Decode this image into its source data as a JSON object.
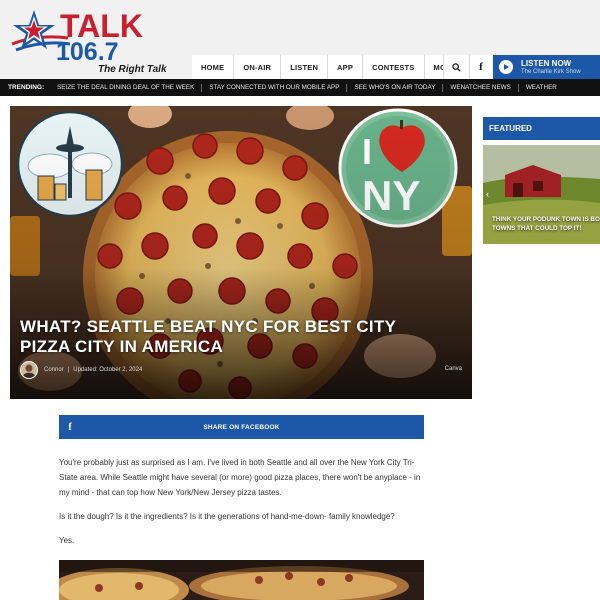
{
  "brand": {
    "logo_talk": "TALK",
    "logo_freq": "106.7",
    "logo_tagline": "The Right Talk"
  },
  "nav": {
    "items": [
      "HOME",
      "ON-AIR",
      "LISTEN",
      "APP",
      "CONTESTS",
      "MORE"
    ],
    "fb_glyph": "f"
  },
  "listen": {
    "title": "LISTEN NOW",
    "subtitle": "The Charlie Kirk Show"
  },
  "trending": {
    "label": "TRENDING:",
    "items": [
      "SEIZE THE DEAL DINING DEAL OF THE WEEK",
      "STAY CONNECTED WITH OUR MOBILE APP",
      "SEE WHO'S ON AIR TODAY",
      "WENATCHEE NEWS",
      "WEATHER"
    ]
  },
  "hero": {
    "title": "WHAT? SEATTLE BEAT NYC FOR BEST CITY PIZZA CITY IN AMERICA",
    "author": "Connor",
    "separator": "|",
    "updated": "Updated: October 2, 2024",
    "credit": "Canva",
    "sticker_ny": "NY",
    "sticker_i": "I"
  },
  "featured": {
    "heading": "FEATURED",
    "caption_line1": "THINK YOUR PODUNK TOWN IS BOR",
    "caption_line2": "TOWNS THAT COULD TOP IT!"
  },
  "share": {
    "icon": "f",
    "label": "SHARE ON FACEBOOK"
  },
  "article": {
    "paragraphs": [
      "You're probably just as surprised as I am. I've lived in both Seattle and all over the New York City Tri-State area. While Seattle might have several (or more) good pizza places, there won't be anyplace - in my mind - that can top how New York/New Jersey pizza tastes.",
      "Is it the dough? Is it the ingredients? Is it the generations of hand-me-down- family knowledge?",
      "Yes."
    ]
  },
  "colors": {
    "brand_blue": "#1c57a8",
    "brand_red": "#c8202f",
    "trending_bg": "#111111"
  }
}
